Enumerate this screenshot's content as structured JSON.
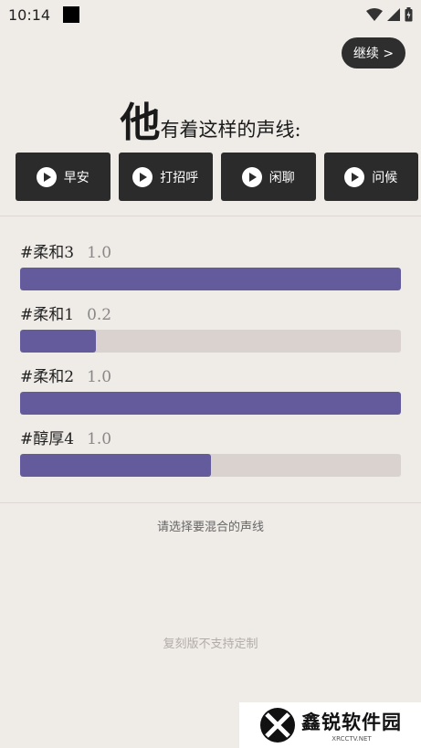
{
  "status_bar": {
    "time": "10:14",
    "icons": [
      "wifi-icon",
      "signal-icon",
      "battery-icon"
    ]
  },
  "header": {
    "continue_label": "继续 >"
  },
  "headline": {
    "big": "他",
    "rest": "有着这样的声线:"
  },
  "samples": [
    {
      "label": "早安"
    },
    {
      "label": "打招呼"
    },
    {
      "label": "闲聊"
    },
    {
      "label": "问候"
    }
  ],
  "voices": [
    {
      "name": "#柔和3",
      "weight": "1.0",
      "level": 1.0
    },
    {
      "name": "#柔和1",
      "weight": "0.2",
      "level": 0.2
    },
    {
      "name": "#柔和2",
      "weight": "1.0",
      "level": 1.0
    },
    {
      "name": "#醇厚4",
      "weight": "1.0",
      "level": 0.5
    }
  ],
  "mix_hint": "请选择要混合的声线",
  "copy_note": "复刻版不支持定制",
  "watermark": {
    "title": "鑫锐软件园",
    "sub": "XRCCTV.NET"
  },
  "colors": {
    "background": "#efebe7",
    "button_dark": "#2b2b2b",
    "bar_fill": "#635b9c",
    "bar_track": "#d9d2cf"
  }
}
